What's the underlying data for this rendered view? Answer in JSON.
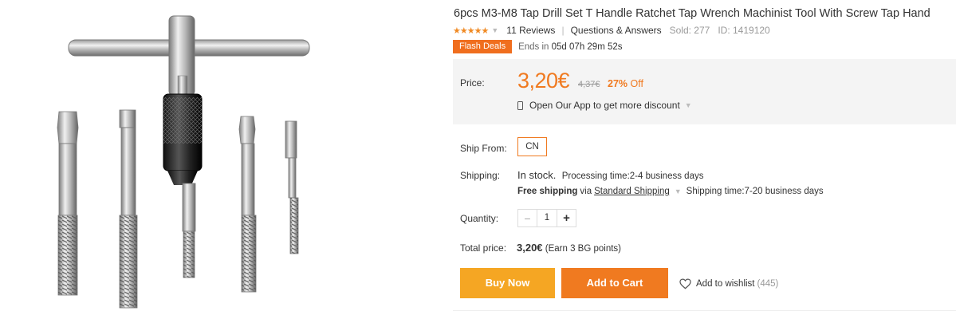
{
  "product": {
    "title": "6pcs M3-M8 Tap Drill Set T Handle Ratchet Tap Wrench Machinist Tool With Screw Tap Hand",
    "image_alt": "Tap wrench with five screw taps",
    "rating": 5,
    "reviews": "11 Reviews",
    "qa": "Questions & Answers",
    "sold": "Sold: 277",
    "id": "ID: 1419120"
  },
  "flash": {
    "badge": "Flash Deals",
    "ends_label": "Ends in",
    "countdown": "05d 07h 29m 52s"
  },
  "price": {
    "label": "Price:",
    "current": "3,20€",
    "old": "4,37€",
    "discount": "27%",
    "discount_suffix": "Off",
    "app_text": "Open Our App to get more discount"
  },
  "shipping": {
    "ship_from_label": "Ship From:",
    "ship_from_value": "CN",
    "shipping_label": "Shipping:",
    "in_stock": "In stock.",
    "processing": "Processing time:2-4 business days",
    "free": "Free shipping",
    "via": "via",
    "method": "Standard Shipping",
    "ship_time": "Shipping time:7-20 business days"
  },
  "quantity": {
    "label": "Quantity:",
    "value": "1",
    "minus": "−",
    "plus": "+"
  },
  "total": {
    "label": "Total price:",
    "value": "3,20€",
    "points": "(Earn 3 BG points)"
  },
  "actions": {
    "buy_now": "Buy Now",
    "add_to_cart": "Add to Cart",
    "wishlist": "Add to wishlist",
    "wishlist_count": "(445)"
  },
  "colors": {
    "accent": "#f07a20",
    "buy_now": "#f5a623",
    "price_bg": "#f4f4f4"
  },
  "icons": [
    "star-icon",
    "chevron-down-icon",
    "phone-icon",
    "heart-icon"
  ]
}
